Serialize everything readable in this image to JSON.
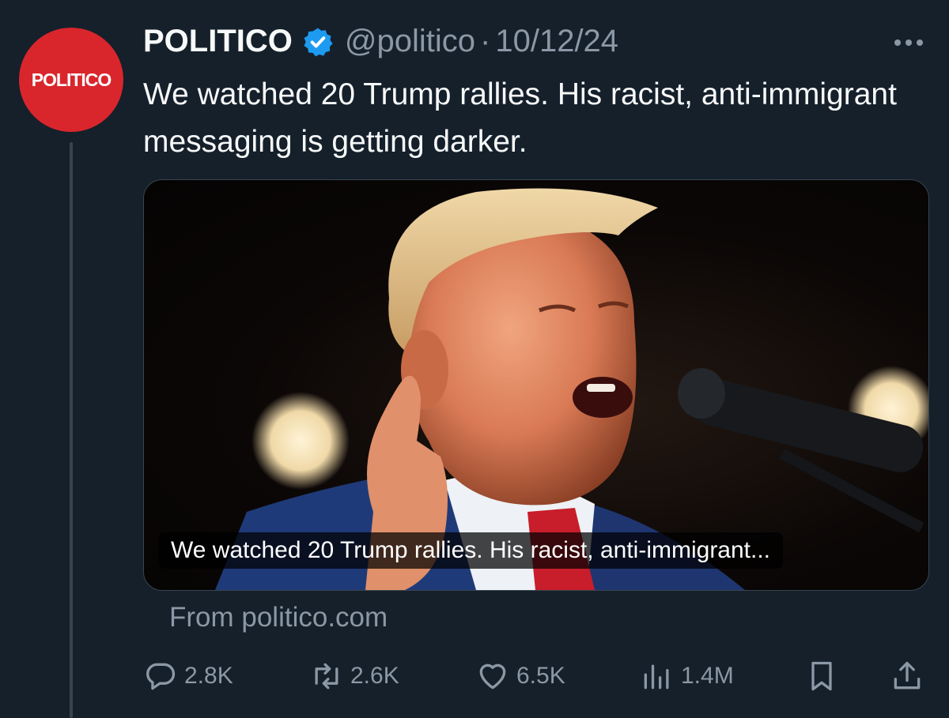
{
  "author": {
    "avatar_text": "POLITICO",
    "display_name": "POLITICO",
    "handle": "@politico",
    "separator": "·",
    "date": "10/12/24",
    "verified_icon": "verified-badge-icon"
  },
  "tweet": {
    "text": "We watched 20 Trump rallies. His racist, anti-immigrant messaging is getting darker."
  },
  "card": {
    "caption": "We watched 20 Trump rallies. His racist, anti-immigrant...",
    "source": "From politico.com"
  },
  "actions": {
    "replies": "2.8K",
    "reposts": "2.6K",
    "likes": "6.5K",
    "views": "1.4M"
  },
  "colors": {
    "background": "#15202b",
    "text": "#f7f9f9",
    "secondary": "#8b98a5",
    "verified": "#1d9bf0",
    "avatar": "#d9262c"
  }
}
